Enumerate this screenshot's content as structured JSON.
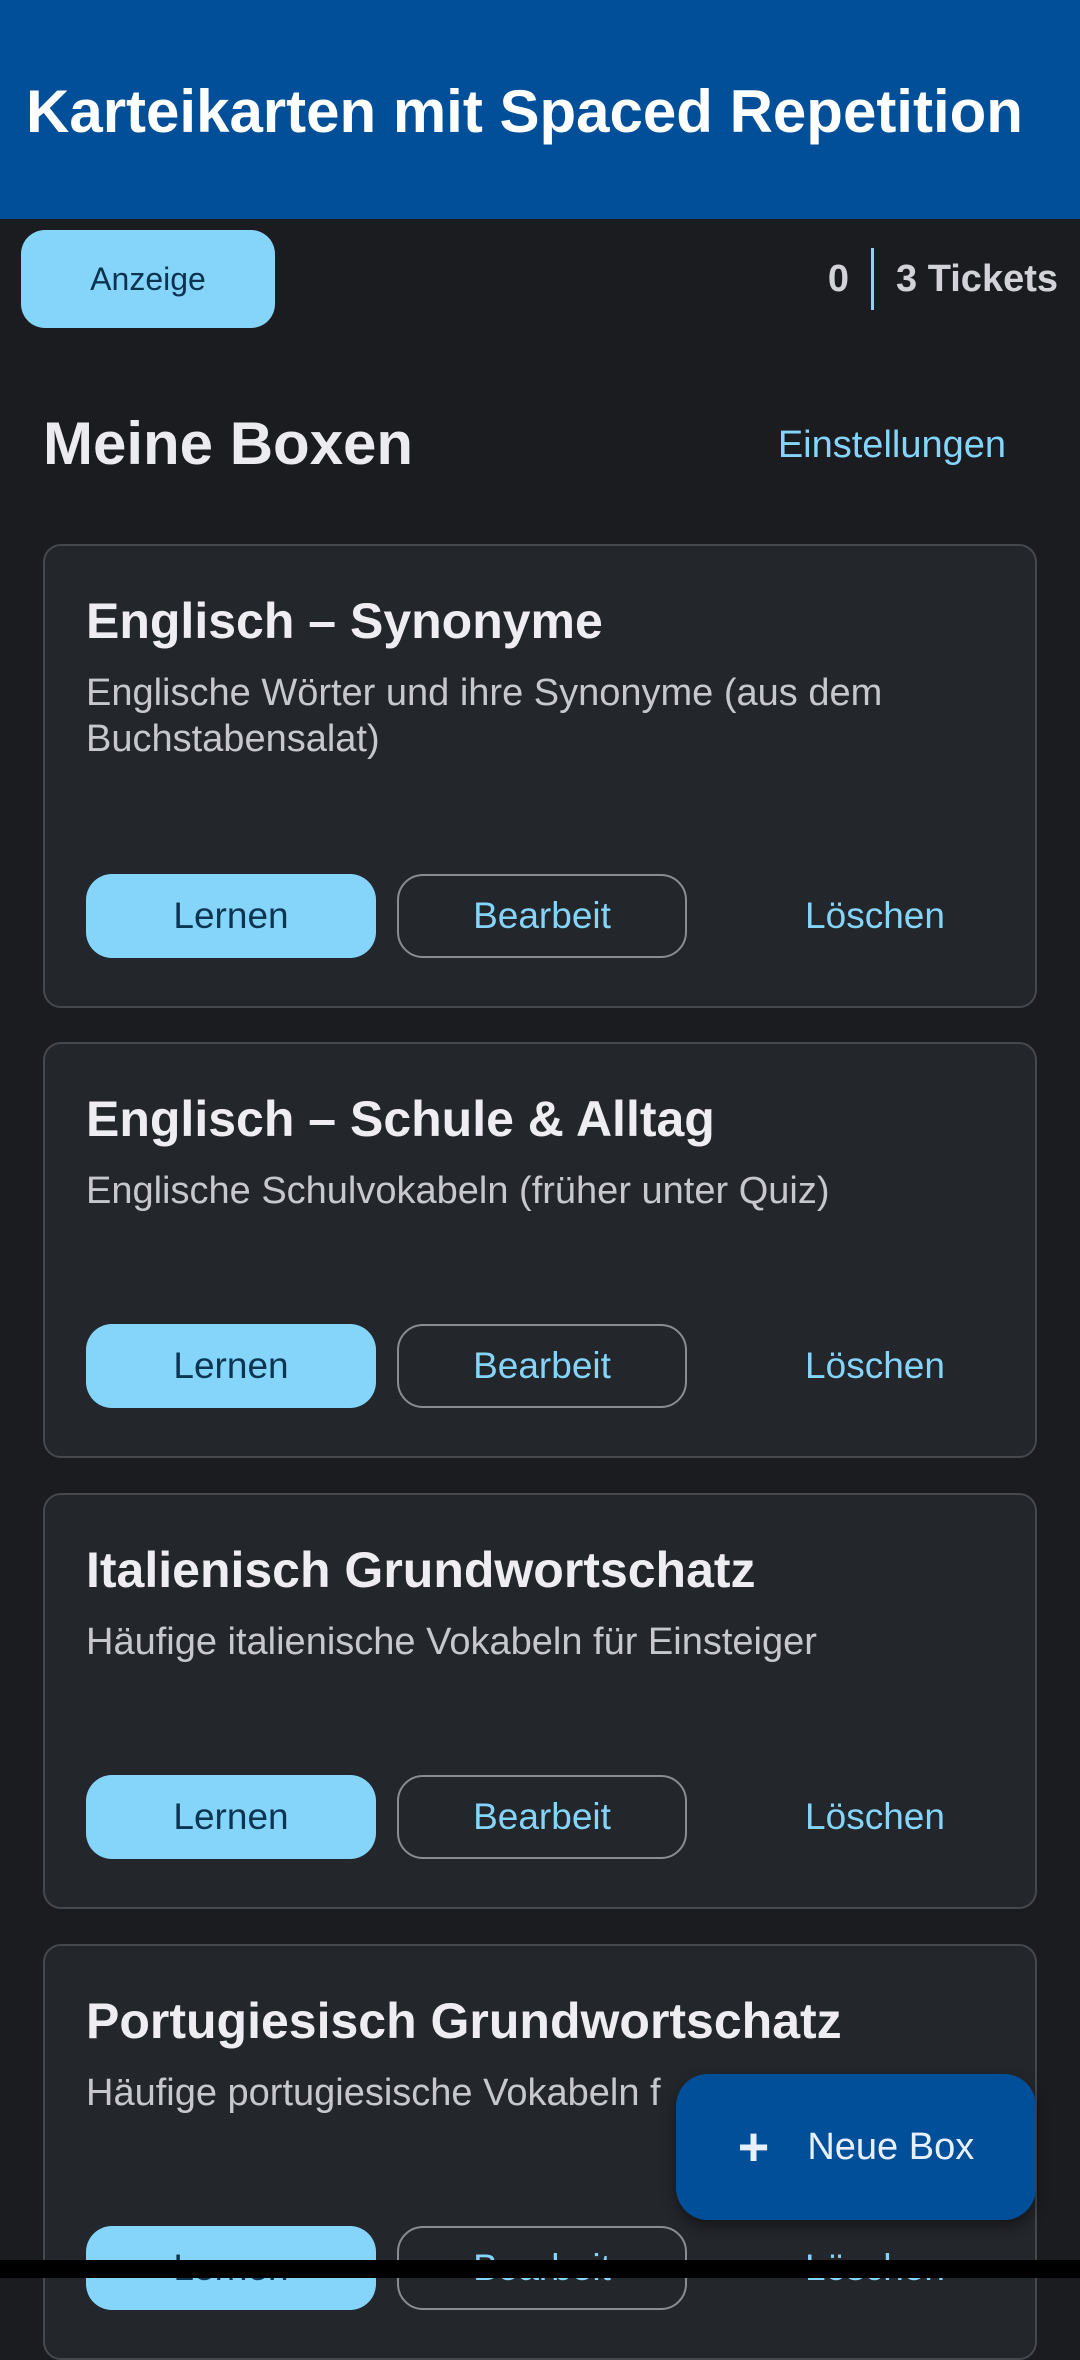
{
  "app_bar": {
    "title": "Karteikarten mit Spaced Repetition"
  },
  "toolbar": {
    "ad_label": "Anzeige",
    "ticket_count": "0",
    "tickets_label": "3 Tickets"
  },
  "section": {
    "title": "Meine Boxen",
    "settings_label": "Einstellungen"
  },
  "boxes": [
    {
      "title": "Englisch – Synonyme",
      "description": "Englische Wörter und ihre Synonyme (aus dem Buchstabensalat)",
      "learn_label": "Lernen",
      "edit_label": "Bearbeit",
      "delete_label": "Löschen"
    },
    {
      "title": "Englisch – Schule & Alltag",
      "description": "Englische Schulvokabeln (früher unter Quiz)",
      "learn_label": "Lernen",
      "edit_label": "Bearbeit",
      "delete_label": "Löschen"
    },
    {
      "title": "Italienisch Grundwortschatz",
      "description": "Häufige italienische Vokabeln für Einsteiger",
      "learn_label": "Lernen",
      "edit_label": "Bearbeit",
      "delete_label": "Löschen"
    },
    {
      "title": "Portugiesisch Grundwortschatz",
      "description": "Häufige portugiesische Vokabeln f",
      "learn_label": "Lernen",
      "edit_label": "Bearbeit",
      "delete_label": "Löschen"
    }
  ],
  "fab": {
    "icon": "plus-icon",
    "label": "Neue Box"
  },
  "colors": {
    "app_bar": "#014f99",
    "background": "#1b1c20",
    "card": "#23262b",
    "accent": "#85d5fb"
  }
}
